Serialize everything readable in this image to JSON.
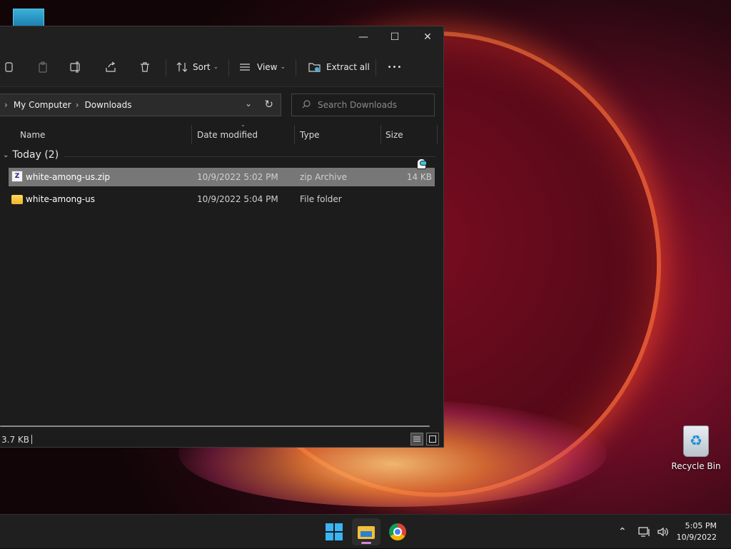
{
  "window": {
    "minimize_icon": "—",
    "maximize_icon": "☐",
    "close_icon": "✕"
  },
  "toolbar": {
    "sort_label": "Sort",
    "view_label": "View",
    "extract_label": "Extract all",
    "more_label": "•••"
  },
  "address": {
    "crumbs": [
      "My Computer",
      "Downloads"
    ]
  },
  "search": {
    "placeholder": "Search Downloads"
  },
  "columns": {
    "name": "Name",
    "date": "Date modified",
    "type": "Type",
    "size": "Size"
  },
  "group": {
    "label": "Today (2)"
  },
  "files": [
    {
      "name": "white-among-us.zip",
      "date": "10/9/2022 5:02 PM",
      "type": "zip Archive",
      "size": "14 KB",
      "icon": "zip-icon",
      "selected": true
    },
    {
      "name": "white-among-us",
      "date": "10/9/2022 5:04 PM",
      "type": "File folder",
      "size": "",
      "icon": "folder-icon",
      "selected": false
    }
  ],
  "status": {
    "text": "3.7 KB"
  },
  "desktop": {
    "recycle_bin_label": "Recycle Bin"
  },
  "taskbar": {
    "time": "5:05 PM",
    "date": "10/9/2022"
  },
  "colors": {
    "selection": "#777777",
    "window_bg": "#1c1c1c",
    "accent": "#3ab4f2"
  }
}
